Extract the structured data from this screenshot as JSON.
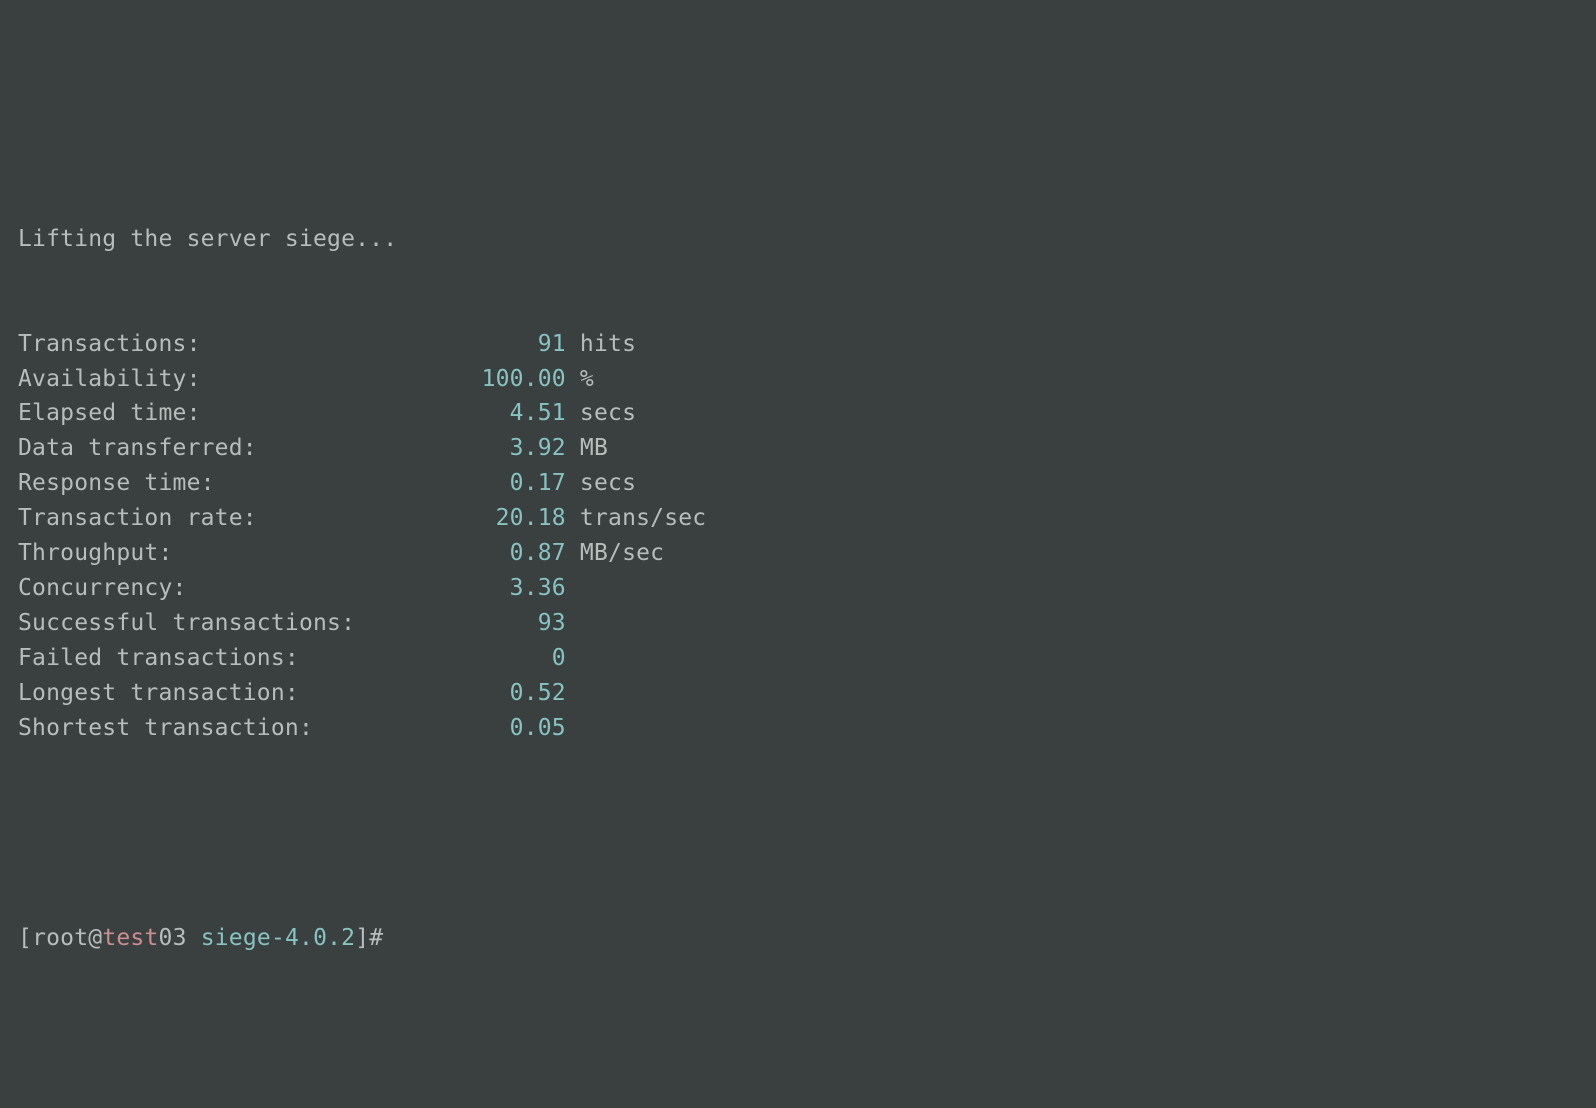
{
  "header": "Lifting the server siege...",
  "stats": [
    {
      "label": "Transactions:",
      "value": "91",
      "unit": "hits"
    },
    {
      "label": "Availability:",
      "value": "100.00",
      "unit": "%"
    },
    {
      "label": "Elapsed time:",
      "value": "4.51",
      "unit": "secs"
    },
    {
      "label": "Data transferred:",
      "value": "3.92",
      "unit": "MB"
    },
    {
      "label": "Response time:",
      "value": "0.17",
      "unit": "secs"
    },
    {
      "label": "Transaction rate:",
      "value": "20.18",
      "unit": "trans/sec"
    },
    {
      "label": "Throughput:",
      "value": "0.87",
      "unit": "MB/sec"
    },
    {
      "label": "Concurrency:",
      "value": "3.36",
      "unit": ""
    },
    {
      "label": "Successful transactions:",
      "value": "93",
      "unit": ""
    },
    {
      "label": "Failed transactions:",
      "value": "0",
      "unit": ""
    },
    {
      "label": "Longest transaction:",
      "value": "0.52",
      "unit": ""
    },
    {
      "label": "Shortest transaction:",
      "value": "0.05",
      "unit": ""
    }
  ],
  "layout": {
    "label_width": 24,
    "value_width": 15
  },
  "prompt": {
    "open": "[",
    "user": "root",
    "at": "@",
    "host": "test",
    "hostnum": "03",
    "dir": "siege-4.0.2",
    "close": "]",
    "hash": "#"
  }
}
